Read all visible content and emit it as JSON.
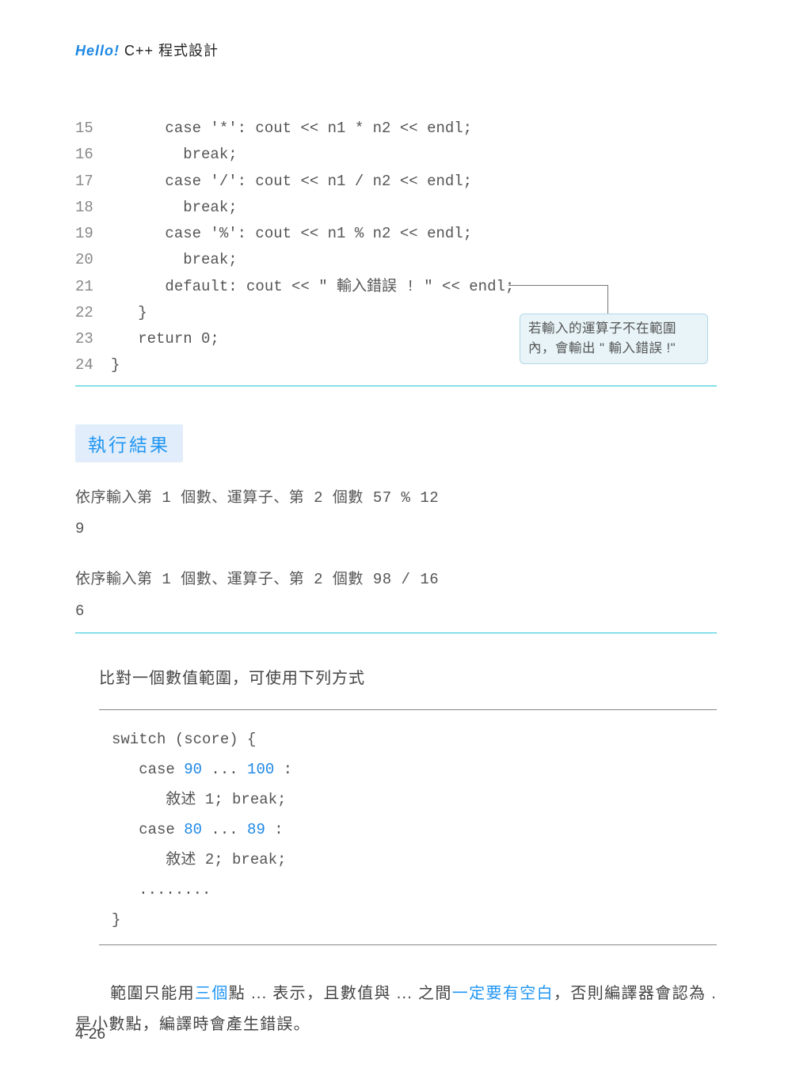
{
  "header": {
    "hello": "Hello!",
    "rest": " C++ 程式設計"
  },
  "code": {
    "lines": [
      {
        "n": "15",
        "t": "      case '*': cout << n1 * n2 << endl;"
      },
      {
        "n": "16",
        "t": "        break;"
      },
      {
        "n": "17",
        "t": "      case '/': cout << n1 / n2 << endl;"
      },
      {
        "n": "18",
        "t": "        break;"
      },
      {
        "n": "19",
        "t": "      case '%': cout << n1 % n2 << endl;"
      },
      {
        "n": "20",
        "t": "        break;"
      },
      {
        "n": "21",
        "t": "      default: cout << \" 輸入錯誤 ! \" << endl;"
      },
      {
        "n": "22",
        "t": "   }"
      },
      {
        "n": "23",
        "t": "   return 0;"
      },
      {
        "n": "24",
        "t": "}"
      }
    ],
    "annotation": "若輸入的運算子不在範圍內，會輸出 \" 輸入錯誤 !\""
  },
  "section_title": "執行結果",
  "run": {
    "line1": "依序輸入第 1 個數、運算子、第 2 個數 57 % 12",
    "line2": "9",
    "line3": "依序輸入第 1 個數、運算子、第 2 個數 98 / 16",
    "line4": "6"
  },
  "body1": "比對一個數值範圍，可使用下列方式",
  "example": {
    "l1": "switch (score) {",
    "l2_a": "   case ",
    "l2_b": "90",
    "l2_c": " ... ",
    "l2_d": "100",
    "l2_e": " :",
    "l3": "      敘述 1; break;",
    "l4_a": "   case ",
    "l4_b": "80",
    "l4_c": " ... ",
    "l4_d": "89",
    "l4_e": " :",
    "l5": "      敘述 2; break;",
    "l6": "   ........",
    "l7": "}"
  },
  "paragraph": {
    "p1_a": "範圍只能用",
    "p1_b": "三個",
    "p1_c": "點 ... 表示，且數值與 ... 之間",
    "p1_d": "一定要有空白",
    "p1_e": "，否則編譯器會認為 . 是小數點，編譯時會產生錯誤。"
  },
  "page_number": "4-26"
}
